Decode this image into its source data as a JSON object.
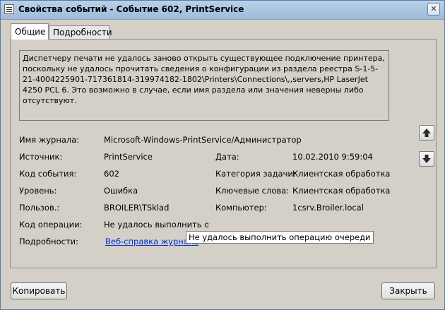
{
  "window": {
    "title": "Свойства событий - Событие 602, PrintService",
    "close_glyph": "✕"
  },
  "tabs": [
    {
      "label": "Общие",
      "active": true
    },
    {
      "label": "Подробности",
      "active": false
    }
  ],
  "description": "Диспетчеру печати не удалось заново открыть существующее подключение принтера, поскольку не удалось прочитать сведения о конфигурации из раздела реестра S-1-5-21-4004225901-717361814-319974182-1802\\Printers\\Connections\\,,servers,HP LaserJet 4250 PCL 6. Это возможно в случае, если имя раздела или значения неверны либо отсутствуют.",
  "fields": {
    "log_name": {
      "label": "Имя журнала:",
      "value": "Microsoft-Windows-PrintService/Администратор"
    },
    "source": {
      "label": "Источник:",
      "value": "PrintService"
    },
    "logged": {
      "label": "Дата:",
      "value": "10.02.2010 9:59:04"
    },
    "event_id": {
      "label": "Код события:",
      "value": "602"
    },
    "task_category": {
      "label": "Категория задачи:",
      "value": "Клиентская обработка"
    },
    "level": {
      "label": "Уровень:",
      "value": "Ошибка"
    },
    "keywords": {
      "label": "Ключевые слова:",
      "value": "Клиентская обработка (CS"
    },
    "user": {
      "label": "Пользов.:",
      "value": "BROILER\\TSklad"
    },
    "computer": {
      "label": "Компьютер:",
      "value": "1csrv.Broiler.local"
    },
    "opcode": {
      "label": "Код операции:",
      "value": "Не удалось выполнить опе"
    },
    "more_info": {
      "label": "Подробности:",
      "value": "Веб-справка журнала"
    }
  },
  "tooltip": "Не удалось выполнить операцию очереди",
  "buttons": {
    "copy": "Копировать",
    "close": "Закрыть",
    "up_icon": "arrow-up-icon",
    "down_icon": "arrow-down-icon"
  },
  "colors": {
    "link": "#0033cc",
    "titlebar": "#b9d1ea",
    "background": "#d4d0c8"
  }
}
